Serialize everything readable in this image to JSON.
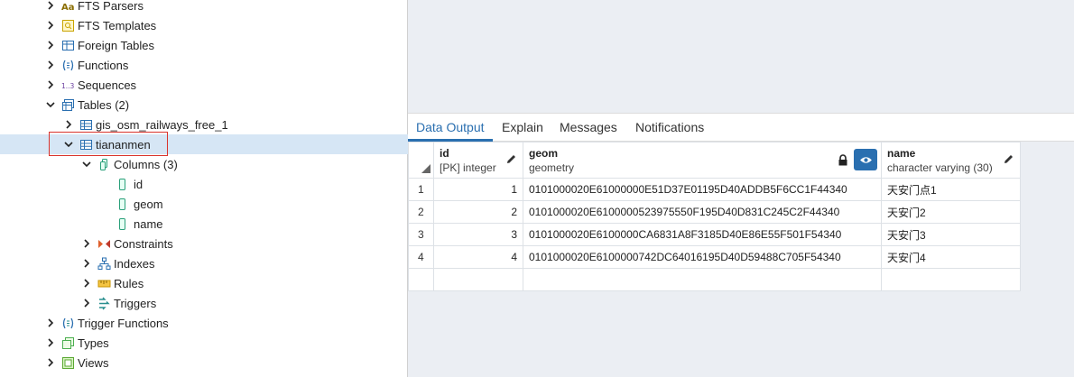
{
  "tree": {
    "items": [
      {
        "label": "FTS Parsers",
        "icon": "fts-parser-icon"
      },
      {
        "label": "FTS Templates",
        "icon": "fts-template-icon"
      },
      {
        "label": "Foreign Tables",
        "icon": "foreign-table-icon"
      },
      {
        "label": "Functions",
        "icon": "function-icon"
      },
      {
        "label": "Sequences",
        "icon": "sequence-icon"
      },
      {
        "label": "Tables (2)",
        "icon": "tables-icon"
      },
      {
        "label": "gis_osm_railways_free_1",
        "icon": "table-icon"
      },
      {
        "label": "tiananmen",
        "icon": "table-icon"
      },
      {
        "label": "Columns (3)",
        "icon": "columns-icon"
      },
      {
        "label": "id",
        "icon": "column-icon"
      },
      {
        "label": "geom",
        "icon": "column-icon"
      },
      {
        "label": "name",
        "icon": "column-icon"
      },
      {
        "label": "Constraints",
        "icon": "constraints-icon"
      },
      {
        "label": "Indexes",
        "icon": "indexes-icon"
      },
      {
        "label": "Rules",
        "icon": "rules-icon"
      },
      {
        "label": "Triggers",
        "icon": "triggers-icon"
      },
      {
        "label": "Trigger Functions",
        "icon": "trigger-function-icon"
      },
      {
        "label": "Types",
        "icon": "types-icon"
      },
      {
        "label": "Views",
        "icon": "views-icon"
      }
    ]
  },
  "tabs": [
    "Data Output",
    "Explain",
    "Messages",
    "Notifications"
  ],
  "grid": {
    "columns": [
      {
        "name": "id",
        "type": "[PK] integer"
      },
      {
        "name": "geom",
        "type": "geometry"
      },
      {
        "name": "name",
        "type": "character varying (30)"
      }
    ],
    "rows": [
      {
        "n": "1",
        "id": "1",
        "geom": "0101000020E61000000E51D37E01195D40ADDB5F6CC1F44340",
        "name": "天安门点1"
      },
      {
        "n": "2",
        "id": "2",
        "geom": "0101000020E6100000523975550F195D40D831C245C2F44340",
        "name": "天安门2"
      },
      {
        "n": "3",
        "id": "3",
        "geom": "0101000020E6100000CA6831A8F3185D40E86E55F501F54340",
        "name": "天安门3"
      },
      {
        "n": "4",
        "id": "4",
        "geom": "0101000020E6100000742DC64016195D40D59488C705F54340",
        "name": "天安门4"
      }
    ]
  },
  "colors": {
    "accent": "#2a6fb0",
    "selection": "#d6e6f5",
    "highlight_box": "#d9332c"
  }
}
